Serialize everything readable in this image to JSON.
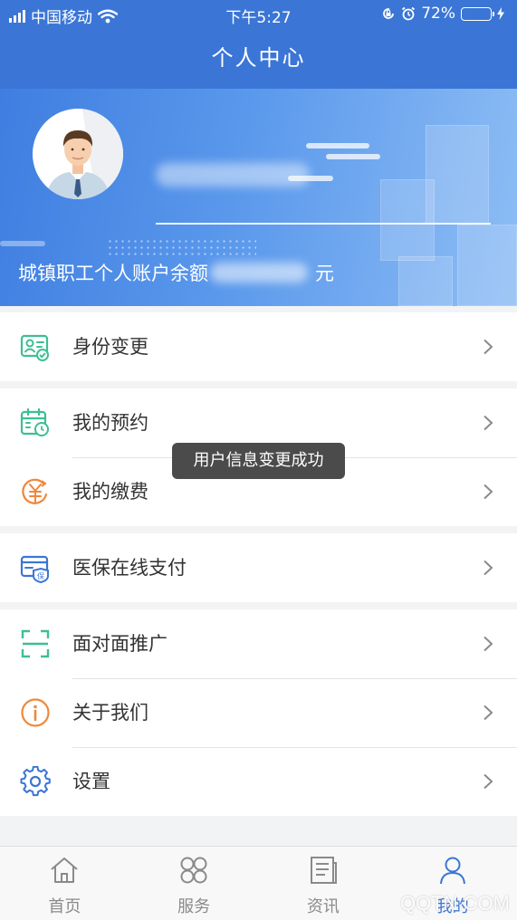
{
  "status_bar": {
    "carrier": "中国移动",
    "time": "下午5:27",
    "battery_percent": "72%",
    "battery_level": 0.72,
    "icons": [
      "signal-icon",
      "wifi-icon",
      "rotation-lock-icon",
      "alarm-icon",
      "battery-icon",
      "charging-icon"
    ]
  },
  "nav": {
    "title": "个人中心"
  },
  "profile": {
    "balance_label": "城镇职工个人账户余额",
    "balance_unit": "元",
    "avatar_icon": "user-avatar-icon"
  },
  "menu": {
    "groups": [
      [
        {
          "label": "身份变更",
          "icon": "id-card-check-icon"
        }
      ],
      [
        {
          "label": "我的预约",
          "icon": "calendar-clock-icon"
        },
        {
          "label": "我的缴费",
          "icon": "yuan-payment-icon"
        }
      ],
      [
        {
          "label": "医保在线支付",
          "icon": "insurance-card-icon"
        }
      ],
      [
        {
          "label": "面对面推广",
          "icon": "scan-frame-icon"
        },
        {
          "label": "关于我们",
          "icon": "info-icon"
        },
        {
          "label": "设置",
          "icon": "gear-icon"
        }
      ]
    ],
    "chevron_icon": "chevron-right-icon"
  },
  "toast": {
    "message": "用户信息变更成功"
  },
  "tabbar": {
    "active_index": 3,
    "tabs": [
      {
        "label": "首页",
        "icon": "home-icon"
      },
      {
        "label": "服务",
        "icon": "grid-icon"
      },
      {
        "label": "资讯",
        "icon": "news-icon"
      },
      {
        "label": "我的",
        "icon": "person-icon"
      }
    ]
  },
  "watermark": "QQTN.COM",
  "colors": {
    "brand_blue": "#3b76d6",
    "icon_green": "#3dbf92",
    "icon_orange": "#f0873a",
    "icon_blue": "#3b76d6",
    "toast_bg": "#3c3c3c",
    "battery_green": "#4cd964"
  }
}
